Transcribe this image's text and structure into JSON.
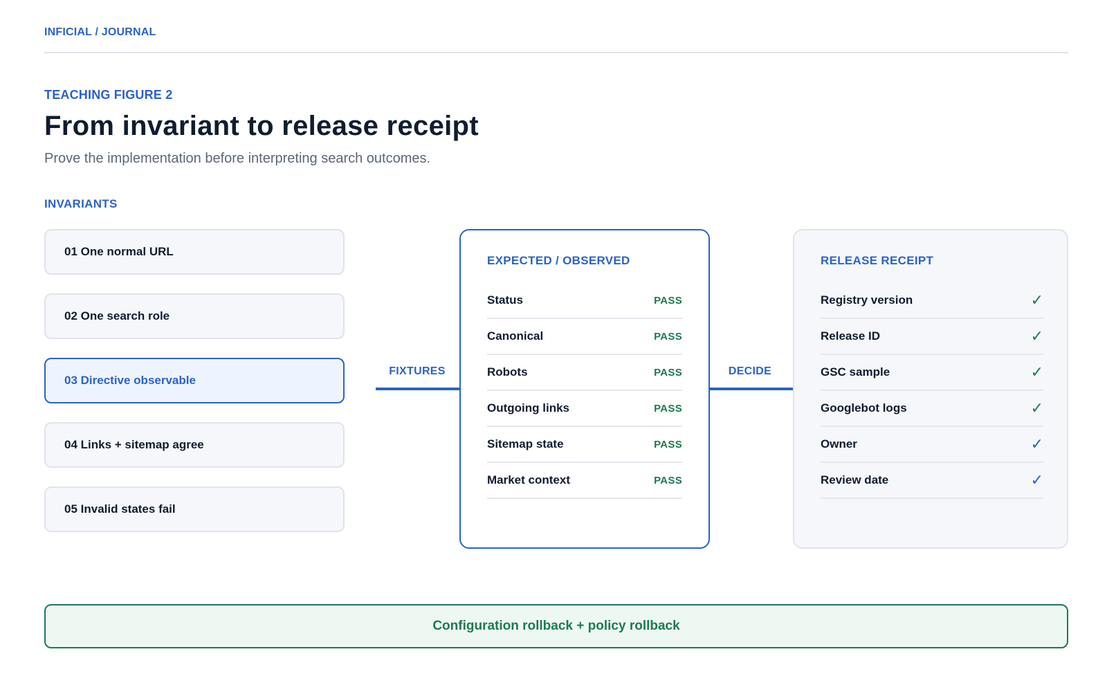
{
  "header": {
    "brand": "INFICIAL / JOURNAL",
    "eyebrow": "TEACHING FIGURE 2",
    "title": "From invariant to release receipt",
    "subtitle": "Prove the implementation before interpreting search outcomes."
  },
  "invariants": {
    "label": "INVARIANTS",
    "items": [
      {
        "label": "01 One normal URL",
        "active": false
      },
      {
        "label": "02 One search role",
        "active": false
      },
      {
        "label": "03 Directive observable",
        "active": true
      },
      {
        "label": "04 Links + sitemap agree",
        "active": false
      },
      {
        "label": "05 Invalid states fail",
        "active": false
      }
    ]
  },
  "connectors": {
    "fixtures": "FIXTURES",
    "decide": "DECIDE"
  },
  "expected": {
    "title": "EXPECTED / OBSERVED",
    "rows": [
      {
        "label": "Status",
        "status": "PASS"
      },
      {
        "label": "Canonical",
        "status": "PASS"
      },
      {
        "label": "Robots",
        "status": "PASS"
      },
      {
        "label": "Outgoing links",
        "status": "PASS"
      },
      {
        "label": "Sitemap state",
        "status": "PASS"
      },
      {
        "label": "Market context",
        "status": "PASS"
      }
    ]
  },
  "receipt": {
    "title": "RELEASE RECEIPT",
    "check_glyph": "✓",
    "rows": [
      {
        "label": "Registry version",
        "check_color": "green"
      },
      {
        "label": "Release ID",
        "check_color": "green"
      },
      {
        "label": "GSC sample",
        "check_color": "green"
      },
      {
        "label": "Googlebot logs",
        "check_color": "green"
      },
      {
        "label": "Owner",
        "check_color": "blue"
      },
      {
        "label": "Review date",
        "check_color": "blue"
      }
    ]
  },
  "rollback": {
    "label": "Configuration rollback + policy rollback"
  },
  "colors": {
    "accent": "#2b63c6",
    "success": "#1d7a52",
    "text": "#111c2e",
    "muted": "#5c6675"
  }
}
